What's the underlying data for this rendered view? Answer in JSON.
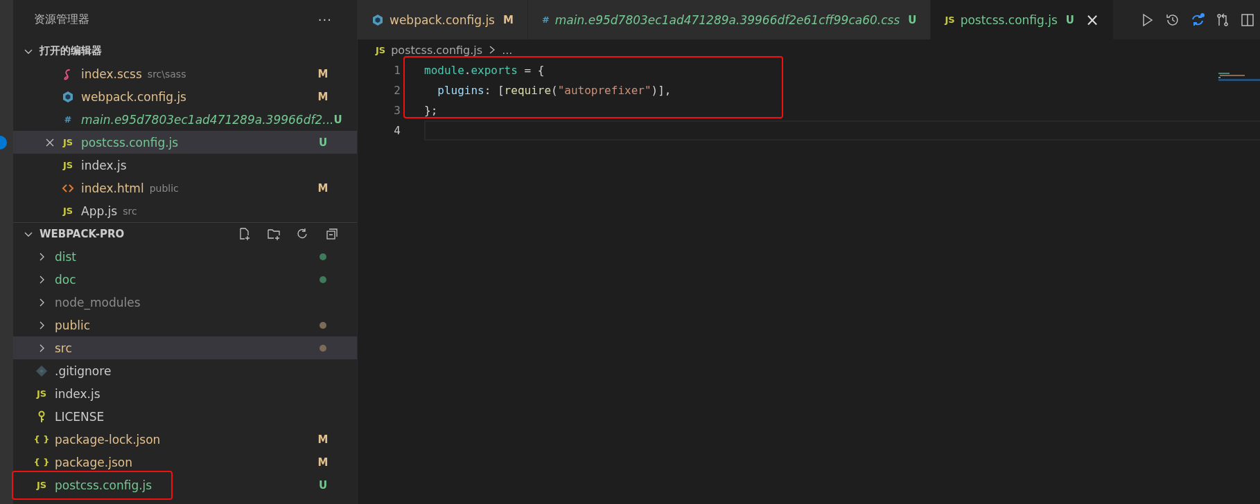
{
  "sidebar": {
    "title": "资源管理器",
    "more": "···",
    "open_editors": {
      "title": "打开的编辑器",
      "expanded": true,
      "items": [
        {
          "icon": {
            "kind": "sass"
          },
          "name": "index.scss",
          "folder": "src\\sass",
          "badge": "M",
          "color": "#e2c08d",
          "italic": false,
          "selected": false
        },
        {
          "icon": {
            "kind": "webpack"
          },
          "name": "webpack.config.js",
          "badge": "M",
          "color": "#e2c08d",
          "italic": false,
          "selected": false
        },
        {
          "icon": {
            "kind": "glyph",
            "text": "#",
            "color": "#519aba"
          },
          "name": "main.e95d7803ec1ad471289a.39966df2...",
          "badge": "U",
          "color": "#73c991",
          "italic": true,
          "selected": false
        },
        {
          "icon": {
            "kind": "glyph",
            "text": "JS",
            "color": "#cbcb41"
          },
          "name": "postcss.config.js",
          "badge": "U",
          "color": "#73c991",
          "italic": false,
          "selected": true
        },
        {
          "icon": {
            "kind": "glyph",
            "text": "JS",
            "color": "#cbcb41"
          },
          "name": "index.js",
          "color": "#cccccc",
          "italic": false,
          "selected": false
        },
        {
          "icon": {
            "kind": "html"
          },
          "name": "index.html",
          "folder": "public",
          "badge": "M",
          "color": "#e2c08d",
          "italic": false,
          "selected": false
        },
        {
          "icon": {
            "kind": "glyph",
            "text": "JS",
            "color": "#cbcb41"
          },
          "name": "App.js",
          "folder": "src",
          "color": "#cccccc",
          "italic": false,
          "selected": false
        }
      ]
    },
    "project": {
      "title": "WEBPACK-PRO",
      "expanded": true,
      "items": [
        {
          "kind": "folder",
          "name": "dist",
          "color": "#73c991",
          "dot": {
            "color": "#3e7b5a"
          },
          "selected": false
        },
        {
          "kind": "folder",
          "name": "doc",
          "color": "#73c991",
          "dot": {
            "color": "#3e7b5a"
          },
          "selected": false
        },
        {
          "kind": "folder",
          "name": "node_modules",
          "color": "#8c8c8c",
          "selected": false
        },
        {
          "kind": "folder",
          "name": "public",
          "color": "#e2c08d",
          "dot": {
            "color": "#7b6b57"
          },
          "selected": false
        },
        {
          "kind": "folder",
          "name": "src",
          "color": "#e2c08d",
          "dot": {
            "color": "#7b6b57"
          },
          "selected": true
        },
        {
          "kind": "file",
          "icon": {
            "kind": "git"
          },
          "name": ".gitignore",
          "color": "#cccccc",
          "selected": false
        },
        {
          "kind": "file",
          "icon": {
            "kind": "glyph",
            "text": "JS",
            "color": "#cbcb41"
          },
          "name": "index.js",
          "color": "#cccccc",
          "selected": false
        },
        {
          "kind": "file",
          "icon": {
            "kind": "license"
          },
          "name": "LICENSE",
          "color": "#cccccc",
          "selected": false
        },
        {
          "kind": "file",
          "icon": {
            "kind": "glyph",
            "text": "{ }",
            "color": "#cbcb41"
          },
          "name": "package-lock.json",
          "badge": "M",
          "color": "#e2c08d",
          "selected": false
        },
        {
          "kind": "file",
          "icon": {
            "kind": "glyph",
            "text": "{ }",
            "color": "#cbcb41"
          },
          "name": "package.json",
          "badge": "M",
          "color": "#e2c08d",
          "selected": false
        },
        {
          "kind": "file",
          "icon": {
            "kind": "glyph",
            "text": "JS",
            "color": "#cbcb41"
          },
          "name": "postcss.config.js",
          "badge": "U",
          "color": "#73c991",
          "selected": false,
          "annotated": true
        }
      ]
    }
  },
  "tabs": [
    {
      "icon": {
        "kind": "webpack"
      },
      "label": "webpack.config.js",
      "badge": "M",
      "color": "#e2c08d",
      "italic": false,
      "selected": false
    },
    {
      "icon": {
        "kind": "glyph",
        "text": "#",
        "color": "#519aba"
      },
      "label": "main.e95d7803ec1ad471289a.39966df2e61cff99ca60.css",
      "badge": "U",
      "color": "#73c991",
      "italic": true,
      "selected": false
    },
    {
      "icon": {
        "kind": "glyph",
        "text": "JS",
        "color": "#cbcb41"
      },
      "label": "postcss.config.js",
      "badge": "U",
      "color": "#73c991",
      "italic": false,
      "selected": true,
      "close": "×"
    }
  ],
  "breadcrumb": {
    "icon": {
      "kind": "glyph",
      "text": "JS",
      "color": "#cbcb41"
    },
    "file": "postcss.config.js",
    "more": "..."
  },
  "code": {
    "annotated": true,
    "lines": [
      {
        "number": "1",
        "current": false,
        "tokens": [
          {
            "text": "module",
            "kind": "variable"
          },
          {
            "text": ".",
            "kind": "punct"
          },
          {
            "text": "exports",
            "kind": "variable"
          },
          {
            "text": " = {",
            "kind": "punct"
          }
        ]
      },
      {
        "number": "2",
        "current": false,
        "tokens": [
          {
            "text": "  plugins",
            "kind": "property"
          },
          {
            "text": ": [",
            "kind": "punct"
          },
          {
            "text": "require",
            "kind": "function"
          },
          {
            "text": "(",
            "kind": "punct"
          },
          {
            "text": "\"autoprefixer\"",
            "kind": "string"
          },
          {
            "text": ")],",
            "kind": "punct"
          }
        ]
      },
      {
        "number": "3",
        "current": false,
        "tokens": [
          {
            "text": "};",
            "kind": "punct"
          }
        ]
      },
      {
        "number": "4",
        "current": true
      }
    ]
  }
}
